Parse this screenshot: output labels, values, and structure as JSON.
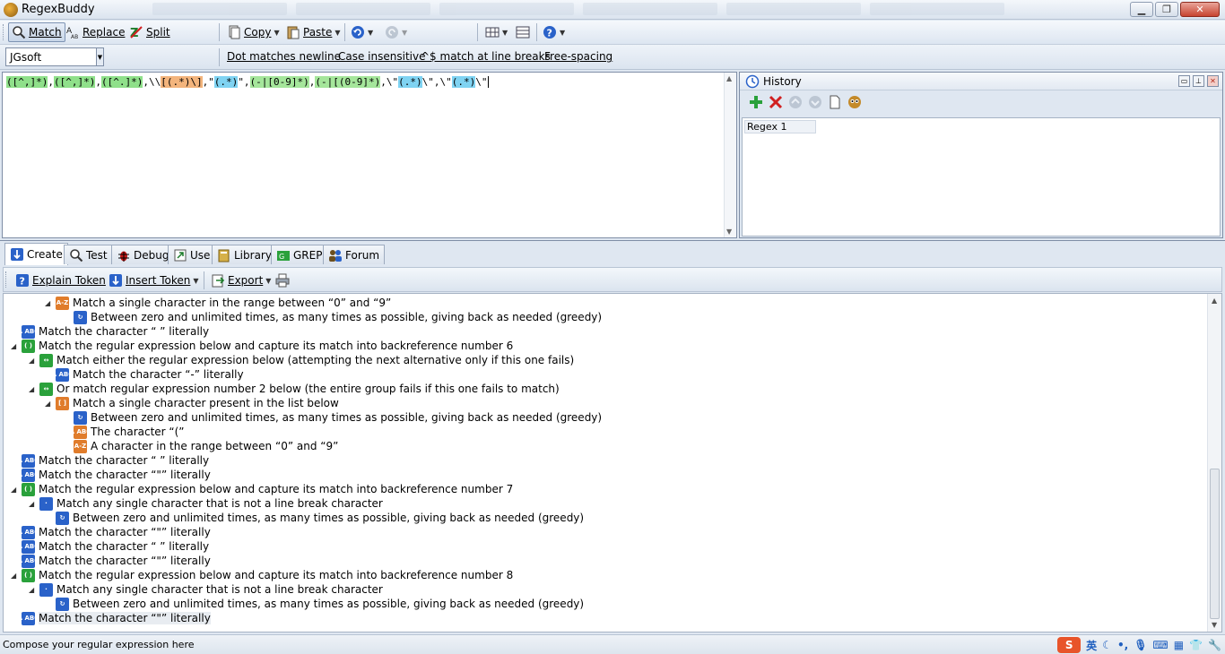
{
  "window": {
    "title": "RegexBuddy"
  },
  "toolbar": {
    "match": "Match",
    "replace": "Replace",
    "split": "Split",
    "copy": "Copy",
    "paste": "Paste"
  },
  "options": {
    "flavor": "JGsoft",
    "dot": "Dot matches newline",
    "case": "Case insensitive",
    "lines": "^$ match at line breaks",
    "free": "Free-spacing"
  },
  "regex_tokens": [
    {
      "t": "([^,]*)",
      "c": "grp"
    },
    {
      "t": ",",
      "c": ""
    },
    {
      "t": "([^,]*)",
      "c": "grp"
    },
    {
      "t": ",",
      "c": ""
    },
    {
      "t": "([^.]*)",
      "c": "grp"
    },
    {
      "t": ",\\\\",
      "c": ""
    },
    {
      "t": "[(.*)\\]",
      "c": "cls"
    },
    {
      "t": ",\"",
      "c": ""
    },
    {
      "t": "(.*)",
      "c": "dot"
    },
    {
      "t": "\",",
      "c": ""
    },
    {
      "t": "(-|[0-9]*)",
      "c": "alt"
    },
    {
      "t": ",",
      "c": ""
    },
    {
      "t": "(-|[(0-9]*)",
      "c": "alt"
    },
    {
      "t": ",\\\"",
      "c": ""
    },
    {
      "t": "(.*)",
      "c": "dot"
    },
    {
      "t": "\\\",\\\"",
      "c": ""
    },
    {
      "t": "(.*)",
      "c": "dot"
    },
    {
      "t": "\\\"",
      "c": "cur"
    }
  ],
  "history": {
    "title": "History",
    "items": [
      "Regex 1"
    ]
  },
  "tabs": [
    "Create",
    "Test",
    "Debug",
    "Use",
    "Library",
    "GREP",
    "Forum"
  ],
  "create_toolbar": {
    "explain": "Explain Token",
    "insert": "Insert Token",
    "export": "Export"
  },
  "tree": [
    {
      "lvl": 3,
      "icon": "rng",
      "glyph": "A-Z",
      "exp": "◢",
      "text": "Match a single character in the range between “0” and “9”"
    },
    {
      "lvl": 4,
      "icon": "q",
      "glyph": "↻",
      "exp": "",
      "text": "Between zero and unlimited times, as many times as possible, giving back as needed (greedy)"
    },
    {
      "lvl": 1,
      "icon": "abc",
      "glyph": "A ABC",
      "exp": "",
      "text": "Match the character “ ” literally"
    },
    {
      "lvl": 1,
      "icon": "grp",
      "glyph": "( )",
      "exp": "◢",
      "text": "Match the regular expression below and capture its match into backreference number 6"
    },
    {
      "lvl": 2,
      "icon": "alt",
      "glyph": "↔",
      "exp": "◢",
      "text": "Match either the regular expression below (attempting the next alternative only if this one fails)"
    },
    {
      "lvl": 3,
      "icon": "abc",
      "glyph": "A ABC",
      "exp": "",
      "text": "Match the character “-” literally"
    },
    {
      "lvl": 2,
      "icon": "alt",
      "glyph": "↔",
      "exp": "◢",
      "text": "Or match regular expression number 2 below (the entire group fails if this one fails to match)"
    },
    {
      "lvl": 3,
      "icon": "set",
      "glyph": "[ ]",
      "exp": "◢",
      "text": "Match a single character present in the list below"
    },
    {
      "lvl": 4,
      "icon": "q",
      "glyph": "↻",
      "exp": "",
      "text": "Between zero and unlimited times, as many times as possible, giving back as needed (greedy)"
    },
    {
      "lvl": 4,
      "icon": "rng",
      "glyph": "A ABC",
      "exp": "",
      "text": "The character “(”"
    },
    {
      "lvl": 4,
      "icon": "rng",
      "glyph": "A-Z",
      "exp": "",
      "text": "A character in the range between “0” and “9”"
    },
    {
      "lvl": 1,
      "icon": "abc",
      "glyph": "A ABC",
      "exp": "",
      "text": "Match the character “ ” literally"
    },
    {
      "lvl": 1,
      "icon": "abc",
      "glyph": "A ABC",
      "exp": "",
      "text": "Match the character “\"” literally"
    },
    {
      "lvl": 1,
      "icon": "grp",
      "glyph": "( )",
      "exp": "◢",
      "text": "Match the regular expression below and capture its match into backreference number 7"
    },
    {
      "lvl": 2,
      "icon": "dot",
      "glyph": "·",
      "exp": "◢",
      "text": "Match any single character that is not a line break character"
    },
    {
      "lvl": 3,
      "icon": "q",
      "glyph": "↻",
      "exp": "",
      "text": "Between zero and unlimited times, as many times as possible, giving back as needed (greedy)"
    },
    {
      "lvl": 1,
      "icon": "abc",
      "glyph": "A ABC",
      "exp": "",
      "text": "Match the character “\"” literally"
    },
    {
      "lvl": 1,
      "icon": "abc",
      "glyph": "A ABC",
      "exp": "",
      "text": "Match the character “ ” literally"
    },
    {
      "lvl": 1,
      "icon": "abc",
      "glyph": "A ABC",
      "exp": "",
      "text": "Match the character “\"” literally"
    },
    {
      "lvl": 1,
      "icon": "grp",
      "glyph": "( )",
      "exp": "◢",
      "text": "Match the regular expression below and capture its match into backreference number 8"
    },
    {
      "lvl": 2,
      "icon": "dot",
      "glyph": "·",
      "exp": "◢",
      "text": "Match any single character that is not a line break character"
    },
    {
      "lvl": 3,
      "icon": "q",
      "glyph": "↻",
      "exp": "",
      "text": "Between zero and unlimited times, as many times as possible, giving back as needed (greedy)"
    },
    {
      "lvl": 1,
      "icon": "abc",
      "glyph": "A ABC",
      "exp": "",
      "text": "Match the character “\"” literally",
      "sel": true
    }
  ],
  "status": {
    "text": "Compose your regular expression here",
    "ime": "英"
  },
  "colors": {
    "group": "#8fe08a",
    "class": "#f3b47c",
    "dot": "#7fd3f2",
    "accent": "#2a62c9"
  }
}
